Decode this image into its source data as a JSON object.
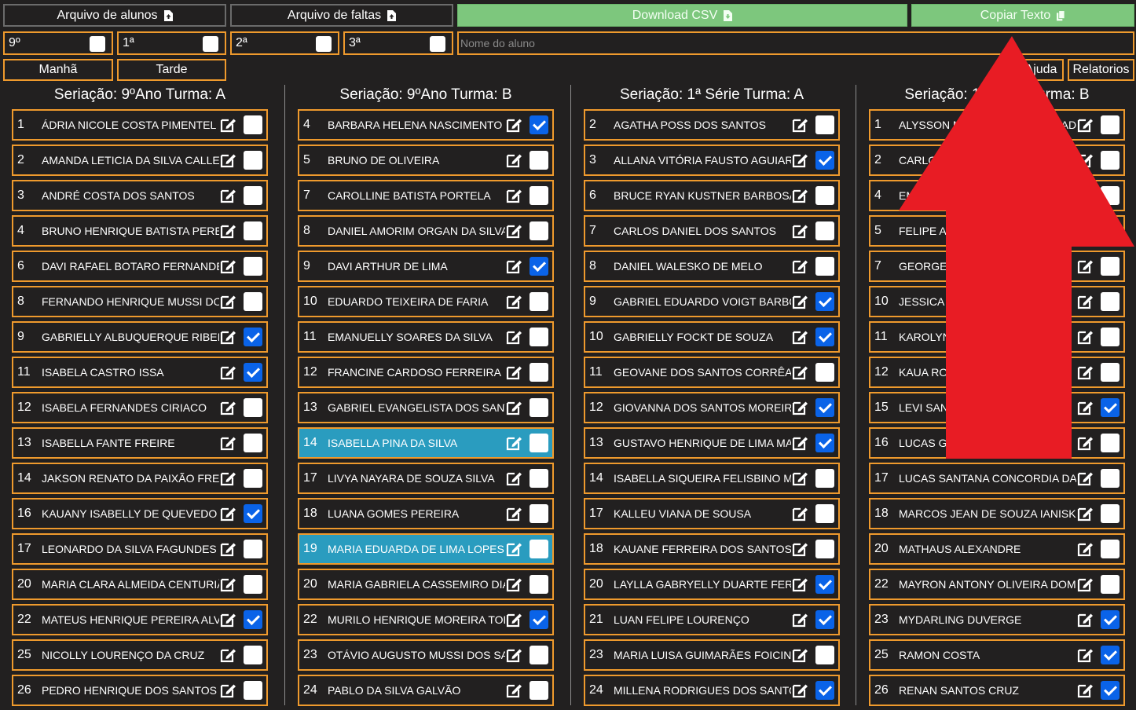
{
  "toolbar": {
    "students_file": "Arquivo de alunos",
    "absences_file": "Arquivo de faltas",
    "download_csv": "Download CSV",
    "copy_text": "Copiar Texto"
  },
  "filters": {
    "grades": [
      {
        "label": "9º",
        "checked": false
      },
      {
        "label": "1ª",
        "checked": false
      },
      {
        "label": "2ª",
        "checked": false
      },
      {
        "label": "3ª",
        "checked": false
      }
    ],
    "name_placeholder": "Nome do aluno",
    "morning": "Manhã",
    "afternoon": "Tarde",
    "help": "Ajuda",
    "reports": "Relatorios"
  },
  "columns": [
    {
      "title": "Seriação: 9ºAno Turma: A",
      "students": [
        {
          "num": "1",
          "name": "ÁDRIA NICOLE COSTA PIMENTEL",
          "checked": false,
          "highlight": false
        },
        {
          "num": "2",
          "name": "AMANDA LETICIA DA SILVA CALLEGARI",
          "checked": false,
          "highlight": false
        },
        {
          "num": "3",
          "name": "ANDRÉ COSTA DOS SANTOS",
          "checked": false,
          "highlight": false
        },
        {
          "num": "4",
          "name": "BRUNO HENRIQUE BATISTA PEREIRA",
          "checked": false,
          "highlight": false
        },
        {
          "num": "6",
          "name": "DAVI RAFAEL BOTARO FERNANDES",
          "checked": false,
          "highlight": false
        },
        {
          "num": "8",
          "name": "FERNANDO HENRIQUE MUSSI DOS",
          "checked": false,
          "highlight": false
        },
        {
          "num": "9",
          "name": "GABRIELLY ALBUQUERQUE RIBEIRO",
          "checked": true,
          "highlight": false
        },
        {
          "num": "11",
          "name": "ISABELA CASTRO ISSA",
          "checked": true,
          "highlight": false
        },
        {
          "num": "12",
          "name": "ISABELA FERNANDES CIRIACO",
          "checked": false,
          "highlight": false
        },
        {
          "num": "13",
          "name": "ISABELLA FANTE FREIRE",
          "checked": false,
          "highlight": false
        },
        {
          "num": "14",
          "name": "JAKSON RENATO DA PAIXÃO FREITAS",
          "checked": false,
          "highlight": false
        },
        {
          "num": "16",
          "name": "KAUANY ISABELLY DE QUEVEDO",
          "checked": true,
          "highlight": false
        },
        {
          "num": "17",
          "name": "LEONARDO DA SILVA FAGUNDES",
          "checked": false,
          "highlight": false
        },
        {
          "num": "20",
          "name": "MARIA CLARA ALMEIDA CENTURIÃO",
          "checked": false,
          "highlight": false
        },
        {
          "num": "22",
          "name": "MATEUS HENRIQUE PEREIRA ALVES",
          "checked": true,
          "highlight": false
        },
        {
          "num": "25",
          "name": "NICOLLY LOURENÇO DA CRUZ",
          "checked": false,
          "highlight": false
        },
        {
          "num": "26",
          "name": "PEDRO HENRIQUE DOS SANTOS",
          "checked": false,
          "highlight": false
        }
      ]
    },
    {
      "title": "Seriação: 9ºAno Turma: B",
      "students": [
        {
          "num": "4",
          "name": "BARBARA HELENA NASCIMENTO",
          "checked": true,
          "highlight": false
        },
        {
          "num": "5",
          "name": "BRUNO DE OLIVEIRA",
          "checked": false,
          "highlight": false
        },
        {
          "num": "7",
          "name": "CAROLLINE BATISTA PORTELA",
          "checked": false,
          "highlight": false
        },
        {
          "num": "8",
          "name": "DANIEL AMORIM ORGAN DA SILVA",
          "checked": false,
          "highlight": false
        },
        {
          "num": "9",
          "name": "DAVI ARTHUR DE LIMA",
          "checked": true,
          "highlight": false
        },
        {
          "num": "10",
          "name": "EDUARDO TEIXEIRA DE FARIA",
          "checked": false,
          "highlight": false
        },
        {
          "num": "11",
          "name": "EMANUELLY SOARES DA SILVA",
          "checked": false,
          "highlight": false
        },
        {
          "num": "12",
          "name": "FRANCINE CARDOSO FERREIRA",
          "checked": false,
          "highlight": false
        },
        {
          "num": "13",
          "name": "GABRIEL EVANGELISTA DOS SANTOS",
          "checked": false,
          "highlight": false
        },
        {
          "num": "14",
          "name": "ISABELLA PINA DA SILVA",
          "checked": false,
          "highlight": true
        },
        {
          "num": "17",
          "name": "LIVYA NAYARA DE SOUZA SILVA",
          "checked": false,
          "highlight": false
        },
        {
          "num": "18",
          "name": "LUANA GOMES PEREIRA",
          "checked": false,
          "highlight": false
        },
        {
          "num": "19",
          "name": "MARIA EDUARDA DE LIMA LOPES",
          "checked": false,
          "highlight": true
        },
        {
          "num": "20",
          "name": "MARIA GABRIELA CASSEMIRO DIAS",
          "checked": false,
          "highlight": false
        },
        {
          "num": "22",
          "name": "MURILO HENRIQUE MOREIRA TOLEDO",
          "checked": true,
          "highlight": false
        },
        {
          "num": "23",
          "name": "OTÁVIO AUGUSTO MUSSI DOS SANTOS",
          "checked": false,
          "highlight": false
        },
        {
          "num": "24",
          "name": "PABLO DA SILVA GALVÃO",
          "checked": false,
          "highlight": false
        }
      ]
    },
    {
      "title": "Seriação: 1ª Série Turma: A",
      "students": [
        {
          "num": "2",
          "name": "AGATHA POSS DOS SANTOS",
          "checked": false,
          "highlight": false
        },
        {
          "num": "3",
          "name": "ALLANA VITÓRIA FAUSTO AGUIAR",
          "checked": true,
          "highlight": false
        },
        {
          "num": "6",
          "name": "BRUCE RYAN KUSTNER BARBOSA",
          "checked": false,
          "highlight": false
        },
        {
          "num": "7",
          "name": "CARLOS DANIEL DOS SANTOS",
          "checked": false,
          "highlight": false
        },
        {
          "num": "8",
          "name": "DANIEL WALESKO DE MELO",
          "checked": false,
          "highlight": false
        },
        {
          "num": "9",
          "name": "GABRIEL EDUARDO VOIGT BARBOSA",
          "checked": true,
          "highlight": false
        },
        {
          "num": "10",
          "name": "GABRIELLY FOCKT DE SOUZA",
          "checked": true,
          "highlight": false
        },
        {
          "num": "11",
          "name": "GEOVANE DOS SANTOS CORRÊA",
          "checked": false,
          "highlight": false
        },
        {
          "num": "12",
          "name": "GIOVANNA DOS SANTOS MOREIRA",
          "checked": true,
          "highlight": false
        },
        {
          "num": "13",
          "name": "GUSTAVO HENRIQUE DE LIMA MACHADO",
          "checked": true,
          "highlight": false
        },
        {
          "num": "14",
          "name": "ISABELLA SIQUEIRA FELISBINO MORAES",
          "checked": false,
          "highlight": false
        },
        {
          "num": "17",
          "name": "KALLEU VIANA DE SOUSA",
          "checked": false,
          "highlight": false
        },
        {
          "num": "18",
          "name": "KAUANE FERREIRA DOS SANTOS",
          "checked": false,
          "highlight": false
        },
        {
          "num": "20",
          "name": "LAYLLA GABRYELLY DUARTE FERREIRA",
          "checked": true,
          "highlight": false
        },
        {
          "num": "21",
          "name": "LUAN FELIPE LOURENÇO",
          "checked": true,
          "highlight": false
        },
        {
          "num": "23",
          "name": "MARIA LUISA GUIMARÃES FOICINHA",
          "checked": false,
          "highlight": false
        },
        {
          "num": "24",
          "name": "MILLENA RODRIGUES DOS SANTOS",
          "checked": true,
          "highlight": false
        }
      ]
    },
    {
      "title": "Seriação: 1ª Série Turma: B",
      "students": [
        {
          "num": "1",
          "name": "ALYSSON MACHADO DE ANDRADE",
          "checked": false,
          "highlight": false
        },
        {
          "num": "2",
          "name": "CARLOS EDUARDO DA SILVA",
          "checked": false,
          "highlight": false
        },
        {
          "num": "4",
          "name": "EMILLY VITÓRIA DE OLIVEIRA",
          "checked": false,
          "highlight": false
        },
        {
          "num": "5",
          "name": "FELIPE AUGUSTO RAMOS",
          "checked": false,
          "highlight": false
        },
        {
          "num": "7",
          "name": "GEORGE LUCAS FERREIRA",
          "checked": false,
          "highlight": false
        },
        {
          "num": "10",
          "name": "JESSICA MARTINS DA COSTA",
          "checked": false,
          "highlight": false
        },
        {
          "num": "11",
          "name": "KAROLYNE SOUZA LIMA",
          "checked": false,
          "highlight": false
        },
        {
          "num": "12",
          "name": "KAUA ROCHA PEREIRA",
          "checked": false,
          "highlight": false
        },
        {
          "num": "15",
          "name": "LEVI SANTOS OLIVEIRA",
          "checked": true,
          "highlight": false
        },
        {
          "num": "16",
          "name": "LUCAS GABRIEL MENDES",
          "checked": false,
          "highlight": false
        },
        {
          "num": "17",
          "name": "LUCAS SANTANA CONCORDIA DA SILVA",
          "checked": false,
          "highlight": false
        },
        {
          "num": "18",
          "name": "MARCOS JEAN DE SOUZA IANISKI",
          "checked": false,
          "highlight": false
        },
        {
          "num": "20",
          "name": "MATHAUS ALEXANDRE",
          "checked": false,
          "highlight": false
        },
        {
          "num": "22",
          "name": "MAYRON ANTONY OLIVEIRA DOMINGUES",
          "checked": false,
          "highlight": false
        },
        {
          "num": "23",
          "name": "MYDARLING DUVERGE",
          "checked": true,
          "highlight": false
        },
        {
          "num": "25",
          "name": "RAMON COSTA",
          "checked": true,
          "highlight": false
        },
        {
          "num": "26",
          "name": "RENAN SANTOS CRUZ",
          "checked": true,
          "highlight": false
        }
      ]
    }
  ],
  "colors": {
    "background": "#222020",
    "border": "#ef9a2d",
    "green": "#7dc77d",
    "highlight": "#2a9cbf",
    "checkbox_on": "#0a63e8",
    "arrow": "#e81c24"
  }
}
